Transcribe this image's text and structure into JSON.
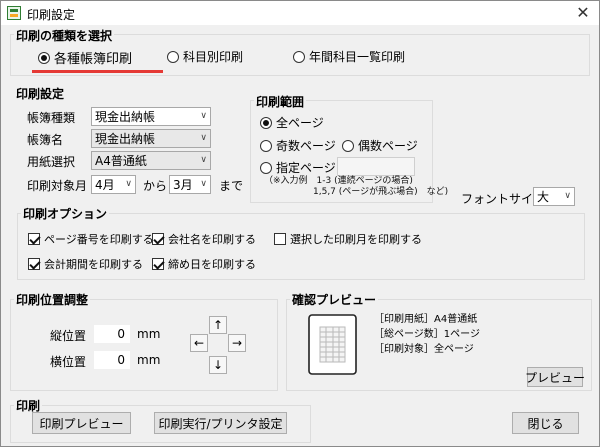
{
  "window": {
    "title": "印刷設定",
    "close_glyph": "✕"
  },
  "type_group": {
    "label": "印刷の種類を選択",
    "options": [
      {
        "label": "各種帳簿印刷",
        "selected": true
      },
      {
        "label": "科目別印刷",
        "selected": false
      },
      {
        "label": "年間科目一覧印刷",
        "selected": false
      }
    ],
    "accent_color": "#e53935"
  },
  "settings_group": {
    "label": "印刷設定",
    "book_type": {
      "label": "帳簿種類",
      "value": "現金出納帳"
    },
    "book_name": {
      "label": "帳簿名",
      "value": "現金出納帳"
    },
    "paper": {
      "label": "用紙選択",
      "value": "A4普通紙"
    },
    "month": {
      "label": "印刷対象月",
      "from": "4月",
      "from_suffix": "から",
      "to": "3月",
      "to_suffix": "まで"
    }
  },
  "range_group": {
    "label": "印刷範囲",
    "all": "全ページ",
    "odd": "奇数ページ",
    "even": "偶数ページ",
    "specified": "指定ページ",
    "specified_value": "",
    "note_line1": "（※入力例　1-3 (連続ページの場合)",
    "note_line2": "1,5,7 (ページが飛ぶ場合)　など)"
  },
  "font_size": {
    "label": "フォントサイズ",
    "value": "大"
  },
  "options_group": {
    "label": "印刷オプション",
    "page_number": {
      "label": "ページ番号を印刷する",
      "checked": true
    },
    "company_name": {
      "label": "会社名を印刷する",
      "checked": true
    },
    "selected_month": {
      "label": "選択した印刷月を印刷する",
      "checked": false
    },
    "fiscal_period": {
      "label": "会計期間を印刷する",
      "checked": true
    },
    "closing_date": {
      "label": "締め日を印刷する",
      "checked": true
    }
  },
  "position_group": {
    "label": "印刷位置調整",
    "vertical": {
      "label": "縦位置",
      "value": "0",
      "unit": "mm"
    },
    "horizontal": {
      "label": "横位置",
      "value": "0",
      "unit": "mm"
    },
    "arrows": {
      "up": "↑",
      "left": "←",
      "right": "→",
      "down": "↓"
    }
  },
  "preview_group": {
    "label": "確認プレビュー",
    "paper_info": "［印刷用紙］A4普通紙",
    "pages_info": "［総ページ数］1ページ",
    "target_info": "［印刷対象］全ページ",
    "preview_button": "プレビュー"
  },
  "print_group": {
    "label": "印刷",
    "preview_button": "印刷プレビュー",
    "execute_button": "印刷実行/プリンタ設定",
    "close_button": "閉じる"
  }
}
